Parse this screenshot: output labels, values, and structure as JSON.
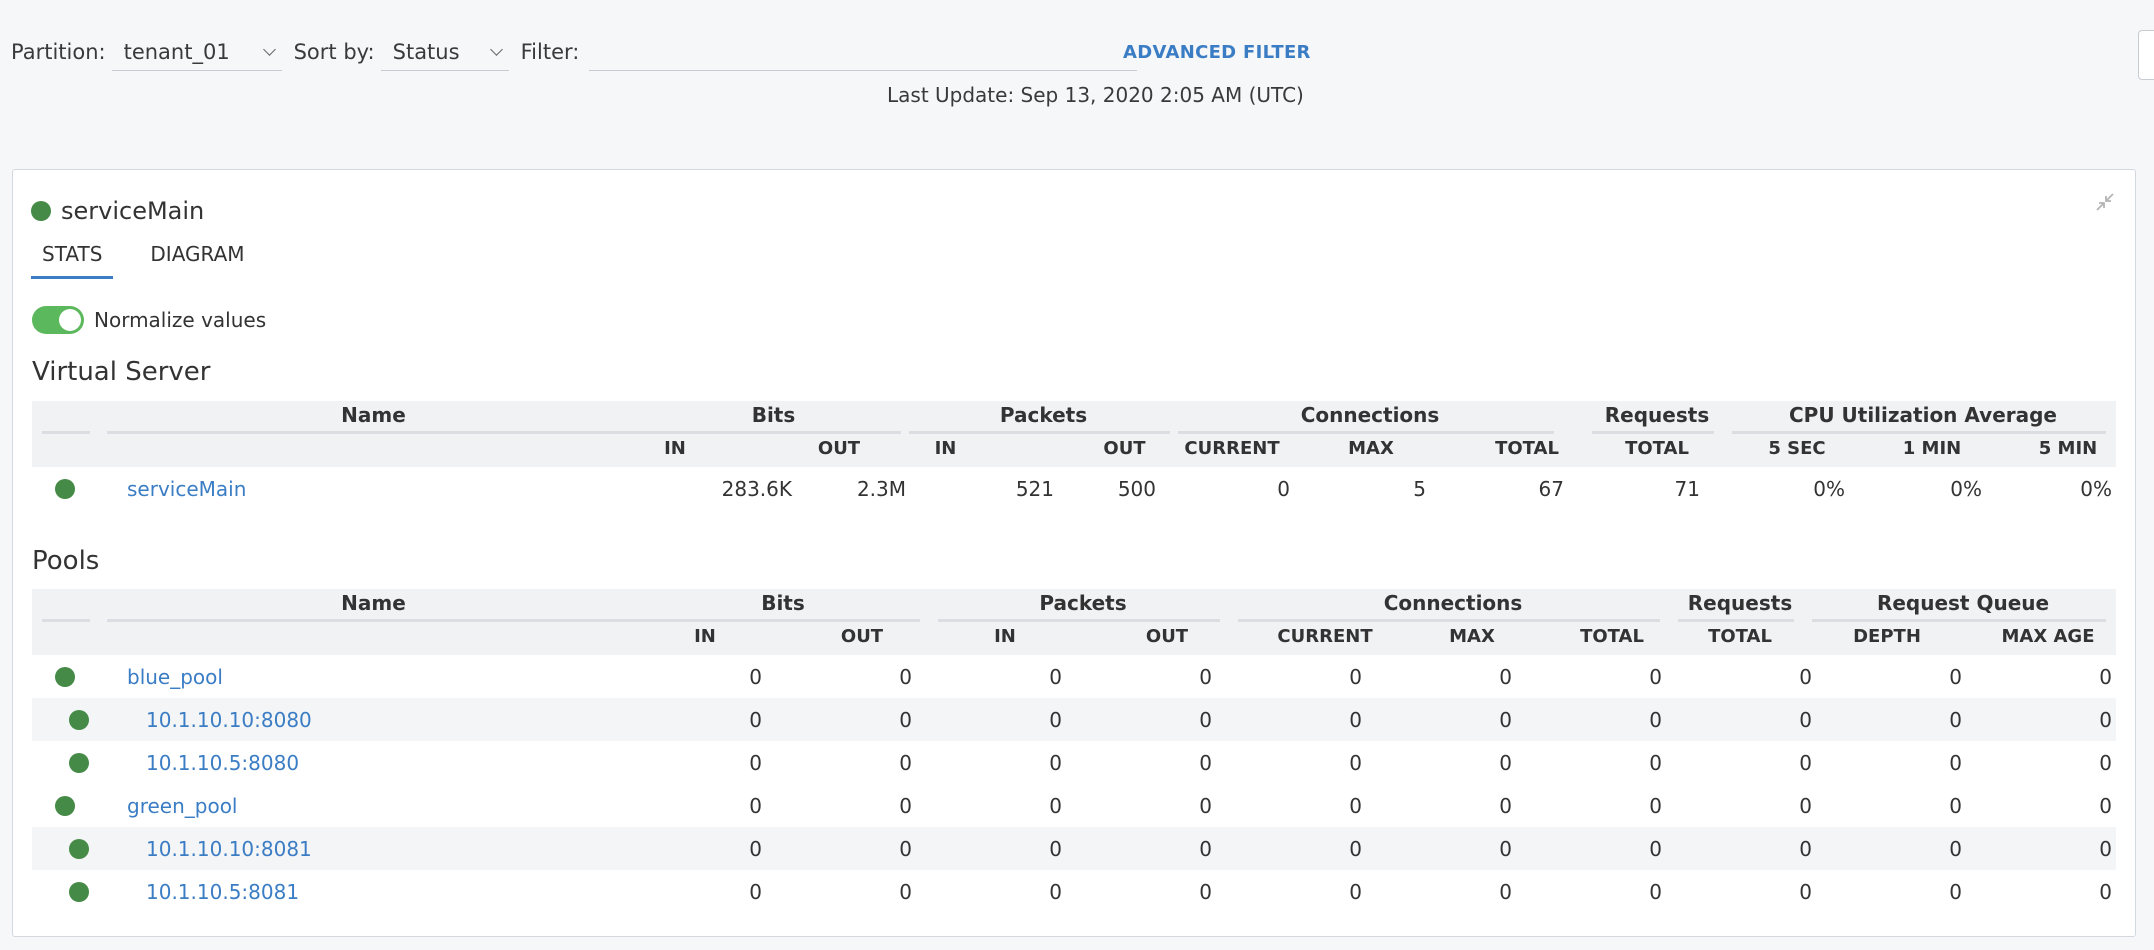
{
  "toolbar": {
    "partition_label": "Partition:",
    "partition_value": "tenant_01",
    "sort_label": "Sort by:",
    "sort_value": "Status",
    "filter_label": "Filter:",
    "filter_value": "",
    "advanced_filter": "ADVANCED FILTER"
  },
  "last_update": "Last Update: Sep 13, 2020 2:05 AM (UTC)",
  "card": {
    "title": "serviceMain",
    "tabs": [
      {
        "label": "STATS",
        "active": true
      },
      {
        "label": "DIAGRAM",
        "active": false
      }
    ],
    "toggle_label": "Normalize values",
    "toggle_on": true
  },
  "status_color": "#458a46",
  "accent_color": "#3b7dc4",
  "virtual_server": {
    "title": "Virtual Server",
    "groups": [
      "Name",
      "Bits",
      "Packets",
      "Connections",
      "Requests",
      "CPU Utilization Average"
    ],
    "subs": [
      "IN",
      "OUT",
      "IN",
      "OUT",
      "CURRENT",
      "MAX",
      "TOTAL",
      "TOTAL",
      "5 SEC",
      "1 MIN",
      "5 MIN"
    ],
    "rows": [
      {
        "name": "serviceMain",
        "values": [
          "283.6K",
          "2.3M",
          "521",
          "500",
          "0",
          "5",
          "67",
          "71",
          "0%",
          "0%",
          "0%"
        ]
      }
    ]
  },
  "pools": {
    "title": "Pools",
    "groups": [
      "Name",
      "Bits",
      "Packets",
      "Connections",
      "Requests",
      "Request Queue"
    ],
    "subs": [
      "IN",
      "OUT",
      "IN",
      "OUT",
      "CURRENT",
      "MAX",
      "TOTAL",
      "TOTAL",
      "DEPTH",
      "MAX AGE"
    ],
    "rows": [
      {
        "name": "blue_pool",
        "member": false,
        "values": [
          "0",
          "0",
          "0",
          "0",
          "0",
          "0",
          "0",
          "0",
          "0",
          "0"
        ]
      },
      {
        "name": "10.1.10.10:8080",
        "member": true,
        "values": [
          "0",
          "0",
          "0",
          "0",
          "0",
          "0",
          "0",
          "0",
          "0",
          "0"
        ]
      },
      {
        "name": "10.1.10.5:8080",
        "member": true,
        "values": [
          "0",
          "0",
          "0",
          "0",
          "0",
          "0",
          "0",
          "0",
          "0",
          "0"
        ]
      },
      {
        "name": "green_pool",
        "member": false,
        "values": [
          "0",
          "0",
          "0",
          "0",
          "0",
          "0",
          "0",
          "0",
          "0",
          "0"
        ]
      },
      {
        "name": "10.1.10.10:8081",
        "member": true,
        "values": [
          "0",
          "0",
          "0",
          "0",
          "0",
          "0",
          "0",
          "0",
          "0",
          "0"
        ]
      },
      {
        "name": "10.1.10.5:8081",
        "member": true,
        "values": [
          "0",
          "0",
          "0",
          "0",
          "0",
          "0",
          "0",
          "0",
          "0",
          "0"
        ]
      }
    ]
  }
}
